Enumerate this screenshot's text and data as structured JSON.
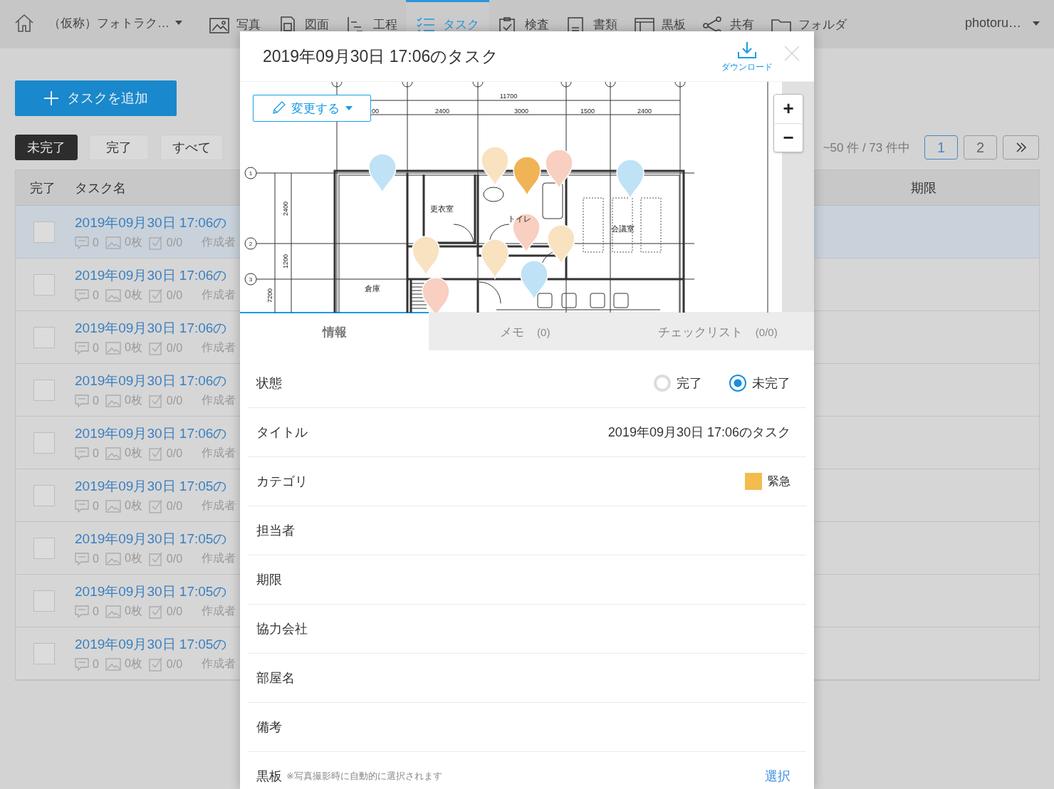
{
  "nav": {
    "project": "（仮称）フォトラク…",
    "items": [
      {
        "kind": "photo",
        "label": "写真",
        "selected": false
      },
      {
        "kind": "drawing",
        "label": "図面",
        "selected": false
      },
      {
        "kind": "schedule",
        "label": "工程",
        "selected": false
      },
      {
        "kind": "task",
        "label": "タスク",
        "selected": true
      },
      {
        "kind": "inspection",
        "label": "検査",
        "selected": false
      },
      {
        "kind": "document",
        "label": "書類",
        "selected": false
      },
      {
        "kind": "board",
        "label": "黒板",
        "selected": false
      },
      {
        "kind": "share",
        "label": "共有",
        "selected": false
      },
      {
        "kind": "folder",
        "label": "フォルダ",
        "selected": false
      }
    ],
    "user": "photoru…"
  },
  "page": {
    "add_button": "タスクを追加",
    "filters": [
      {
        "label": "未完了",
        "selected": true
      },
      {
        "label": "完了",
        "selected": false
      },
      {
        "label": "すべて",
        "selected": false
      }
    ],
    "pagination": {
      "range": "~50 件 / 73 件中",
      "pages": [
        {
          "label": "1",
          "selected": true
        },
        {
          "label": "2",
          "selected": false
        }
      ]
    }
  },
  "table": {
    "columns": [
      "完了",
      "タスク名",
      "期限"
    ],
    "rows": [
      {
        "title": "2019年09月30日 17:06の",
        "comments": "0",
        "photos": "0枚",
        "checklist": "0/0",
        "creator": "作成者",
        "checked": false,
        "selected": true
      },
      {
        "title": "2019年09月30日 17:06の",
        "comments": "0",
        "photos": "0枚",
        "checklist": "0/0",
        "creator": "作成者",
        "checked": false,
        "selected": false
      },
      {
        "title": "2019年09月30日 17:06の",
        "comments": "0",
        "photos": "0枚",
        "checklist": "0/0",
        "creator": "作成者",
        "checked": false,
        "selected": false
      },
      {
        "title": "2019年09月30日 17:06の",
        "comments": "0",
        "photos": "0枚",
        "checklist": "0/0",
        "creator": "作成者",
        "checked": false,
        "selected": false
      },
      {
        "title": "2019年09月30日 17:06の",
        "comments": "0",
        "photos": "0枚",
        "checklist": "0/0",
        "creator": "作成者",
        "checked": false,
        "selected": false
      },
      {
        "title": "2019年09月30日 17:05の",
        "comments": "0",
        "photos": "0枚",
        "checklist": "0/0",
        "creator": "作成者",
        "checked": false,
        "selected": false
      },
      {
        "title": "2019年09月30日 17:05の",
        "comments": "0",
        "photos": "0枚",
        "checklist": "0/0",
        "creator": "作成者",
        "checked": false,
        "selected": false
      },
      {
        "title": "2019年09月30日 17:05の",
        "comments": "0",
        "photos": "0枚",
        "checklist": "0/0",
        "creator": "作成者",
        "checked": false,
        "selected": false
      },
      {
        "title": "2019年09月30日 17:05の",
        "comments": "0",
        "photos": "0枚",
        "checklist": "0/0",
        "creator": "作成者",
        "checked": false,
        "selected": false
      }
    ]
  },
  "modal": {
    "title": "2019年09月30日 17:06のタスク",
    "download": "ダウンロード",
    "change_button": "変更する",
    "zoom": [
      "+",
      "−"
    ],
    "plan": {
      "overall": "11700",
      "spans": [
        "00",
        "2400",
        "3000",
        "1500",
        "2400"
      ],
      "axes": [
        "1",
        "2",
        "3"
      ],
      "side": [
        "2400",
        "1200",
        "7200"
      ],
      "rooms": [
        "更衣室",
        "トイレ",
        "会議室",
        "倉庫"
      ],
      "pins": [
        {
          "color": "#bfe2f6"
        },
        {
          "color": "#f8e2c0"
        },
        {
          "color": "#f8cfc0"
        },
        {
          "color": "#f0b456"
        },
        {
          "color": "#bfe2f6"
        },
        {
          "color": "#f8cfc0"
        },
        {
          "color": "#f8e2c0"
        },
        {
          "color": "#f8e2c0"
        },
        {
          "color": "#f8e2c0"
        },
        {
          "color": "#bfe2f6"
        },
        {
          "color": "#f8cfc0"
        }
      ]
    },
    "tabs": [
      {
        "label": "情報",
        "selected": true
      },
      {
        "label": "メモ",
        "count": "(0)",
        "selected": false
      },
      {
        "label": "チェックリスト",
        "count": "(0/0)",
        "selected": false
      }
    ],
    "fields": [
      {
        "kind": "radio",
        "label": "状態",
        "options": [
          {
            "label": "完了",
            "selected": false
          },
          {
            "label": "未完了",
            "selected": true
          }
        ]
      },
      {
        "kind": "text",
        "label": "タイトル",
        "value": "2019年09月30日 17:06のタスク"
      },
      {
        "kind": "category",
        "label": "カテゴリ",
        "value": "緊急",
        "color": "#f3bc4f"
      },
      {
        "kind": "text",
        "label": "担当者"
      },
      {
        "kind": "text",
        "label": "期限"
      },
      {
        "kind": "text",
        "label": "協力会社"
      },
      {
        "kind": "text",
        "label": "部屋名"
      },
      {
        "kind": "text",
        "label": "備考"
      },
      {
        "kind": "link",
        "label": "黒板",
        "note": "※写真撮影時に自動的に選択されます",
        "action": "選択"
      }
    ]
  }
}
